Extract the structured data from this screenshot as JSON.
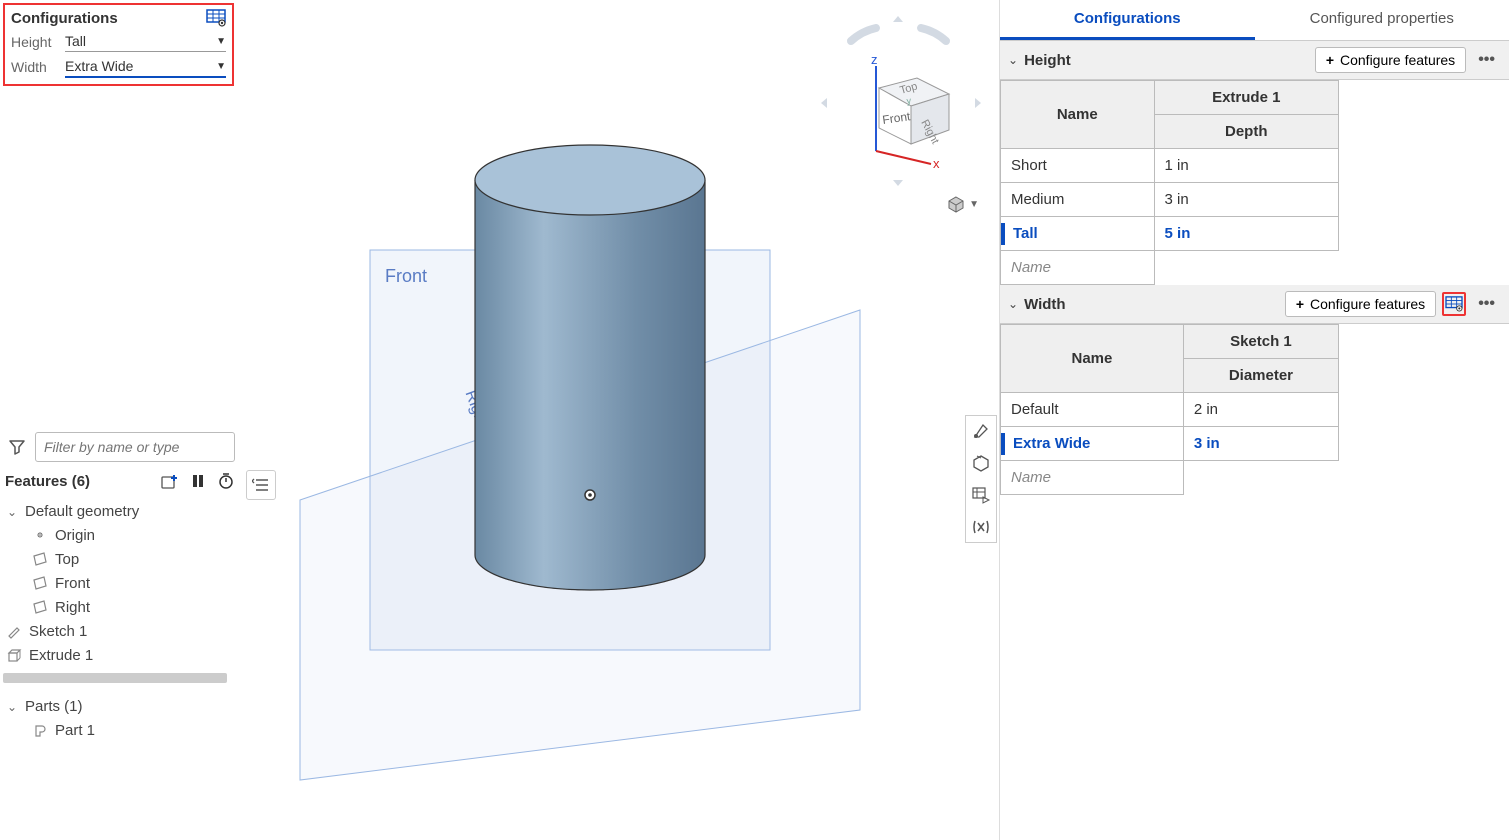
{
  "cfgPanel": {
    "title": "Configurations",
    "rows": [
      {
        "label": "Height",
        "value": "Tall",
        "active": false
      },
      {
        "label": "Width",
        "value": "Extra Wide",
        "active": true
      }
    ]
  },
  "filter": {
    "placeholder": "Filter by name or type"
  },
  "features": {
    "title": "Features (6)",
    "tree": [
      {
        "type": "parent",
        "label": "Default geometry"
      },
      {
        "type": "child",
        "icon": "origin",
        "label": "Origin"
      },
      {
        "type": "child",
        "icon": "plane",
        "label": "Top"
      },
      {
        "type": "child",
        "icon": "plane",
        "label": "Front"
      },
      {
        "type": "child",
        "icon": "plane",
        "label": "Right"
      },
      {
        "type": "feature",
        "icon": "sketch",
        "label": "Sketch 1"
      },
      {
        "type": "feature",
        "icon": "extrude",
        "label": "Extrude 1"
      }
    ],
    "partsTitle": "Parts (1)",
    "parts": [
      {
        "label": "Part 1"
      }
    ]
  },
  "viewCube": {
    "axes": {
      "x": "x",
      "y": "y",
      "z": "z"
    },
    "faces": {
      "front": "Front",
      "right": "Right",
      "top": "Top"
    }
  },
  "planeLabels": {
    "front": "Front",
    "right": "Right"
  },
  "tabs": {
    "active": "Configurations",
    "other": "Configured properties"
  },
  "configureBtn": "Configure features",
  "tables": [
    {
      "title": "Height",
      "featureCol": "Extrude 1",
      "nameHeader": "Name",
      "paramHeader": "Depth",
      "rows": [
        {
          "name": "Short",
          "val": "1 in",
          "selected": false
        },
        {
          "name": "Medium",
          "val": "3 in",
          "selected": false
        },
        {
          "name": "Tall",
          "val": "5 in",
          "selected": true
        }
      ],
      "placeholder": "Name",
      "iconBoxed": false
    },
    {
      "title": "Width",
      "featureCol": "Sketch 1",
      "nameHeader": "Name",
      "paramHeader": "Diameter",
      "rows": [
        {
          "name": "Default",
          "val": "2 in",
          "selected": false
        },
        {
          "name": "Extra Wide",
          "val": "3 in",
          "selected": true
        }
      ],
      "placeholder": "Name",
      "iconBoxed": true
    }
  ]
}
